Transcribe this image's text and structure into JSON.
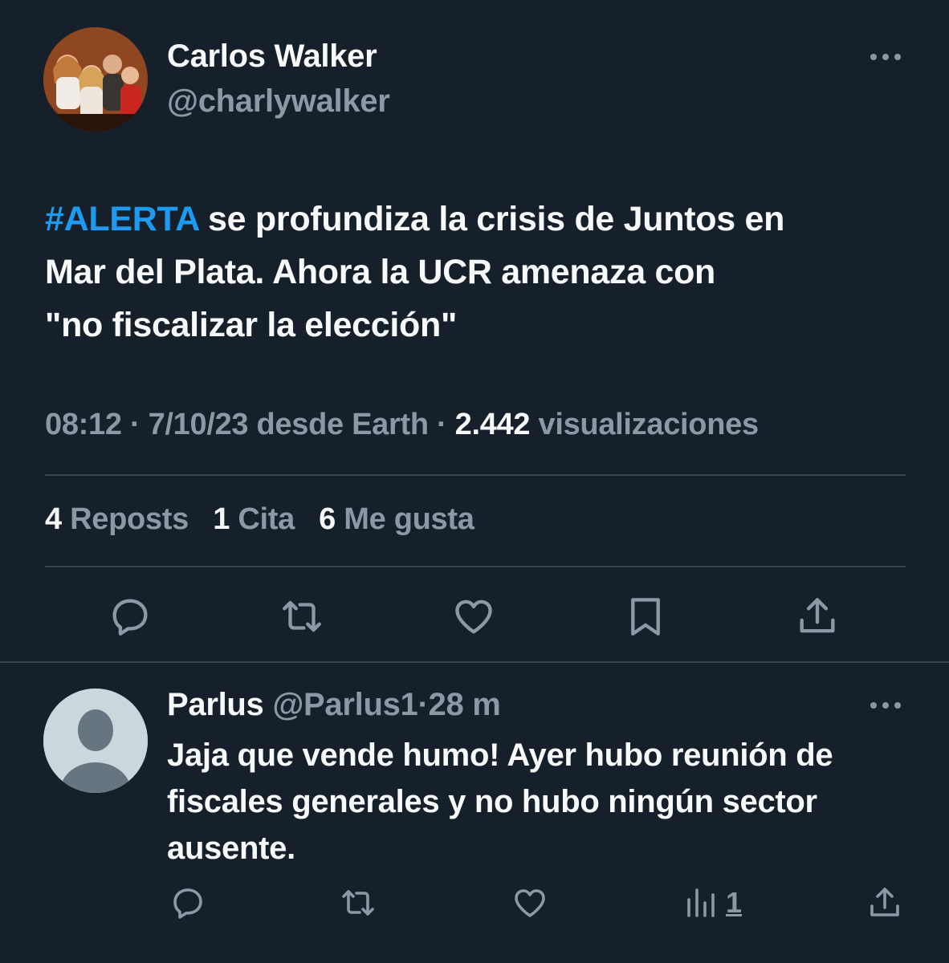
{
  "tweet": {
    "author_name": "Carlos Walker",
    "author_handle": "@charlywalker",
    "text_hashtag": "#ALERTA",
    "text_line1_rest": " se profundiza la crisis de Juntos en",
    "text_line2": "Mar del Plata. Ahora la UCR amenaza con",
    "text_line3": "\"no fiscalizar la elección\"",
    "time": "08:12",
    "date": "7/10/23 desde Earth",
    "views_count": "2.442",
    "views_label": "visualizaciones",
    "separator": " · ",
    "stats": {
      "reposts_count": "4",
      "reposts_label": "Reposts",
      "quotes_count": "1",
      "quotes_label": "Cita",
      "likes_count": "6",
      "likes_label": "Me gusta"
    },
    "icons": [
      "reply-icon",
      "repost-icon",
      "like-icon",
      "bookmark-icon",
      "share-icon"
    ]
  },
  "reply": {
    "author_name": "Parlus",
    "author_handle": "@Parlus1",
    "age": "28 m",
    "separator": "·",
    "text_line1": "Jaja que vende humo! Ayer hubo reunión de",
    "text_line2": "fiscales generales y no hubo ningún sector",
    "text_line3": "ausente.",
    "views_count": "1",
    "icons": [
      "reply-icon",
      "repost-icon",
      "like-icon",
      "views-icon",
      "share-icon"
    ]
  },
  "colors": {
    "background": "#15202b",
    "text_primary": "#f7f9f9",
    "text_secondary": "#8b98a5",
    "accent": "#1d9bf0",
    "divider": "#38444d"
  }
}
